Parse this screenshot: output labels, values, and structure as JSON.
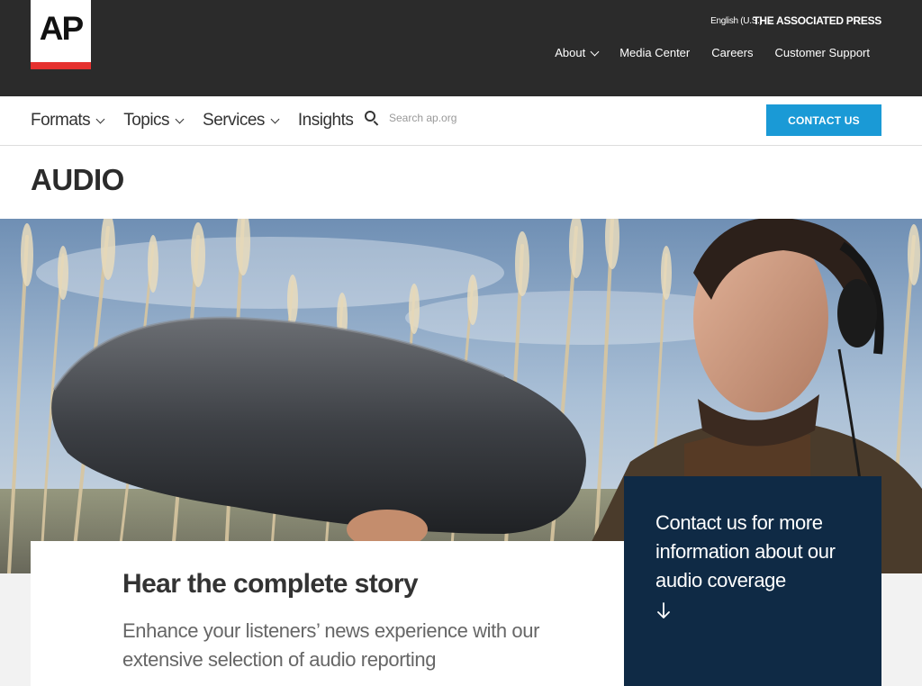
{
  "brand": {
    "logo_text": "AP",
    "language": "English (U.S.)",
    "name": "THE ASSOCIATED PRESS",
    "accent_red": "#e5312f"
  },
  "top_nav": [
    {
      "label": "About",
      "has_dropdown": true
    },
    {
      "label": "Media Center",
      "has_dropdown": false
    },
    {
      "label": "Careers",
      "has_dropdown": false
    },
    {
      "label": "Customer Support",
      "has_dropdown": false
    }
  ],
  "main_nav": [
    {
      "label": "Formats",
      "has_dropdown": true
    },
    {
      "label": "Topics",
      "has_dropdown": true
    },
    {
      "label": "Services",
      "has_dropdown": true
    },
    {
      "label": "Insights",
      "has_dropdown": false
    }
  ],
  "search": {
    "placeholder": "Search ap.org",
    "icon": "search-icon"
  },
  "contact_button": {
    "label": "CONTACT US",
    "color": "#1a9ad6"
  },
  "page": {
    "title": "AUDIO"
  },
  "story": {
    "title": "Hear the complete story",
    "description": "Enhance your listeners’ news experience with our extensive selection of audio reporting"
  },
  "cta": {
    "text": "Contact us for more information about our audio coverage",
    "icon": "arrow-down-icon",
    "color": "#0f2a45"
  }
}
